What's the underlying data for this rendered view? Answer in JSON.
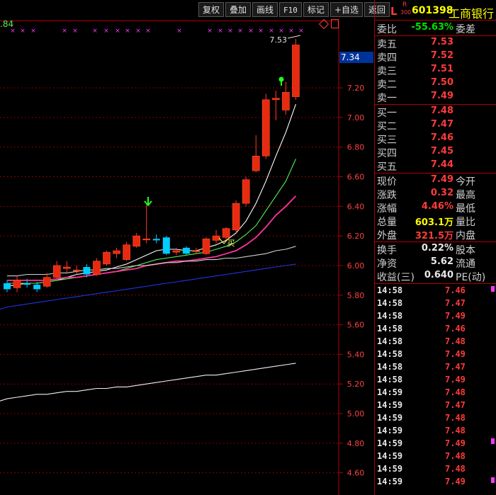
{
  "toolbar": {
    "buttons": [
      "复权",
      "叠加",
      "画线",
      "F10",
      "标记",
      "+自选",
      "返回"
    ]
  },
  "chart": {
    "top_left_value": ".84",
    "current_price_box": "7.34",
    "high_marker_label": "7.53",
    "buy_label": "买",
    "corner_icons": [
      "diamond-icon",
      "window-icon"
    ]
  },
  "stock": {
    "flag": "L",
    "sub_flag_top": "R",
    "sub_flag_bottom": "300",
    "code": "601398",
    "name": "工商银行"
  },
  "order_book": {
    "weibi_label": "委比",
    "weibi_value": "-55.63%",
    "weicha_label": "委差",
    "asks": [
      {
        "label": "卖五",
        "price": "7.53"
      },
      {
        "label": "卖四",
        "price": "7.52"
      },
      {
        "label": "卖三",
        "price": "7.51"
      },
      {
        "label": "卖二",
        "price": "7.50"
      },
      {
        "label": "卖一",
        "price": "7.49"
      }
    ],
    "bids": [
      {
        "label": "买一",
        "price": "7.48"
      },
      {
        "label": "买二",
        "price": "7.47"
      },
      {
        "label": "买三",
        "price": "7.46"
      },
      {
        "label": "买四",
        "price": "7.45"
      },
      {
        "label": "买五",
        "price": "7.44"
      }
    ]
  },
  "quote": {
    "rows": [
      {
        "k": "现价",
        "v": "7.49",
        "k2": "今开",
        "color": "red"
      },
      {
        "k": "涨跌",
        "v": "0.32",
        "k2": "最高",
        "color": "red"
      },
      {
        "k": "涨幅",
        "v": "4.46%",
        "k2": "最低",
        "color": "red"
      },
      {
        "k": "总量",
        "v": "603.1万",
        "k2": "量比",
        "color": "yellow"
      },
      {
        "k": "外盘",
        "v": "321.5万",
        "k2": "内盘",
        "color": "red"
      }
    ],
    "rows2": [
      {
        "k": "换手",
        "v": "0.22%",
        "k2": "股本",
        "color": "white"
      },
      {
        "k": "净资",
        "v": "5.62",
        "k2": "流通",
        "color": "white"
      },
      {
        "k": "收益(三)",
        "v": "0.640",
        "k2": "PE(动)",
        "color": "white"
      }
    ]
  },
  "ticks": [
    {
      "time": "14:58",
      "price": "7.46"
    },
    {
      "time": "14:58",
      "price": "7.47"
    },
    {
      "time": "14:58",
      "price": "7.49"
    },
    {
      "time": "14:58",
      "price": "7.46"
    },
    {
      "time": "14:58",
      "price": "7.48"
    },
    {
      "time": "14:58",
      "price": "7.49"
    },
    {
      "time": "14:58",
      "price": "7.47"
    },
    {
      "time": "14:58",
      "price": "7.49"
    },
    {
      "time": "14:59",
      "price": "7.48"
    },
    {
      "time": "14:59",
      "price": "7.47"
    },
    {
      "time": "14:59",
      "price": "7.48"
    },
    {
      "time": "14:59",
      "price": "7.48"
    },
    {
      "time": "14:59",
      "price": "7.49"
    },
    {
      "time": "14:59",
      "price": "7.48"
    },
    {
      "time": "14:59",
      "price": "7.48"
    },
    {
      "time": "14:59",
      "price": "7.49"
    }
  ],
  "chart_data": {
    "type": "candlestick",
    "y_axis_ticks": [
      "7.20",
      "7.00",
      "6.80",
      "6.60",
      "6.40",
      "6.20",
      "6.00",
      "5.80",
      "5.60",
      "5.40",
      "5.20",
      "5.00",
      "4.80",
      "4.60"
    ],
    "ylim": [
      4.45,
      7.65
    ],
    "candles": [
      {
        "o": 5.88,
        "c": 5.84,
        "h": 5.9,
        "l": 5.82
      },
      {
        "o": 5.85,
        "c": 5.9,
        "h": 5.93,
        "l": 5.82
      },
      {
        "o": 5.88,
        "c": 5.87,
        "h": 5.91,
        "l": 5.85
      },
      {
        "o": 5.87,
        "c": 5.84,
        "h": 5.89,
        "l": 5.82
      },
      {
        "o": 5.86,
        "c": 5.92,
        "h": 5.95,
        "l": 5.85
      },
      {
        "o": 5.92,
        "c": 6.0,
        "h": 6.03,
        "l": 5.9
      },
      {
        "o": 5.98,
        "c": 5.99,
        "h": 6.03,
        "l": 5.95
      },
      {
        "o": 5.97,
        "c": 5.97,
        "h": 6.0,
        "l": 5.94
      },
      {
        "o": 5.99,
        "c": 5.94,
        "h": 6.01,
        "l": 5.92
      },
      {
        "o": 5.94,
        "c": 6.03,
        "h": 6.05,
        "l": 5.93
      },
      {
        "o": 6.01,
        "c": 6.09,
        "h": 6.1,
        "l": 6.0
      },
      {
        "o": 6.08,
        "c": 6.1,
        "h": 6.12,
        "l": 6.05
      },
      {
        "o": 6.04,
        "c": 6.14,
        "h": 6.16,
        "l": 6.03
      },
      {
        "o": 6.13,
        "c": 6.2,
        "h": 6.22,
        "l": 6.12
      },
      {
        "o": 6.18,
        "c": 6.18,
        "h": 6.41,
        "l": 6.15
      },
      {
        "o": 6.18,
        "c": 6.17,
        "h": 6.21,
        "l": 6.15
      },
      {
        "o": 6.19,
        "c": 6.08,
        "h": 6.2,
        "l": 6.07
      },
      {
        "o": 6.09,
        "c": 6.1,
        "h": 6.12,
        "l": 6.07
      },
      {
        "o": 6.12,
        "c": 6.08,
        "h": 6.13,
        "l": 6.07
      },
      {
        "o": 6.1,
        "c": 6.1,
        "h": 6.12,
        "l": 6.08
      },
      {
        "o": 6.08,
        "c": 6.18,
        "h": 6.19,
        "l": 6.07
      },
      {
        "o": 6.17,
        "c": 6.2,
        "h": 6.24,
        "l": 6.15
      },
      {
        "o": 6.19,
        "c": 6.25,
        "h": 6.26,
        "l": 6.17
      },
      {
        "o": 6.24,
        "c": 6.42,
        "h": 6.44,
        "l": 6.22
      },
      {
        "o": 6.42,
        "c": 6.58,
        "h": 6.6,
        "l": 6.4
      },
      {
        "o": 6.64,
        "c": 6.74,
        "h": 6.88,
        "l": 6.63
      },
      {
        "o": 6.74,
        "c": 7.12,
        "h": 7.16,
        "l": 6.72
      },
      {
        "o": 7.12,
        "c": 7.13,
        "h": 7.18,
        "l": 6.98
      },
      {
        "o": 7.05,
        "c": 7.17,
        "h": 7.24,
        "l": 7.02
      },
      {
        "o": 7.14,
        "c": 7.49,
        "h": 7.53,
        "l": 7.12
      }
    ],
    "series": [
      {
        "name": "white-ma",
        "color": "#ffffff",
        "values": [
          5.86,
          5.87,
          5.88,
          5.88,
          5.89,
          5.9,
          5.92,
          5.94,
          5.95,
          5.96,
          5.97,
          5.99,
          6.01,
          6.04,
          6.07,
          6.1,
          6.11,
          6.11,
          6.1,
          6.1,
          6.12,
          6.14,
          6.17,
          6.22,
          6.3,
          6.42,
          6.57,
          6.74,
          6.9,
          7.09
        ]
      },
      {
        "name": "green-ma",
        "color": "#55ee55",
        "values": [
          5.88,
          5.88,
          5.88,
          5.88,
          5.89,
          5.9,
          5.91,
          5.92,
          5.93,
          5.94,
          5.95,
          5.96,
          5.98,
          6.0,
          6.02,
          6.04,
          6.05,
          6.06,
          6.07,
          6.08,
          6.09,
          6.11,
          6.13,
          6.16,
          6.21,
          6.27,
          6.37,
          6.47,
          6.57,
          6.72
        ]
      },
      {
        "name": "magenta-ma",
        "color": "#ff3399",
        "values": [
          5.9,
          5.9,
          5.9,
          5.9,
          5.9,
          5.91,
          5.92,
          5.92,
          5.93,
          5.94,
          5.95,
          5.96,
          5.97,
          5.98,
          6.0,
          6.01,
          6.02,
          6.03,
          6.03,
          6.04,
          6.05,
          6.06,
          6.08,
          6.1,
          6.14,
          6.19,
          6.26,
          6.34,
          6.4,
          6.47
        ]
      },
      {
        "name": "gray-ma",
        "color": "#d0d0d0",
        "values": [
          5.93,
          5.93,
          5.94,
          5.94,
          5.94,
          5.95,
          5.95,
          5.96,
          5.97,
          5.97,
          5.98,
          5.98,
          5.99,
          6.0,
          6.0,
          6.01,
          6.02,
          6.02,
          6.03,
          6.03,
          6.04,
          6.04,
          6.05,
          6.05,
          6.06,
          6.07,
          6.08,
          6.1,
          6.11,
          6.13
        ]
      },
      {
        "name": "blue-ma",
        "color": "#2233dd",
        "values": [
          5.72,
          5.73,
          5.74,
          5.75,
          5.76,
          5.77,
          5.78,
          5.79,
          5.8,
          5.81,
          5.82,
          5.83,
          5.84,
          5.85,
          5.86,
          5.87,
          5.88,
          5.89,
          5.9,
          5.91,
          5.92,
          5.93,
          5.94,
          5.95,
          5.96,
          5.97,
          5.98,
          5.99,
          6.0,
          6.01
        ]
      },
      {
        "name": "white-long-ma",
        "color": "#f0f0f0",
        "values": [
          5.1,
          5.11,
          5.12,
          5.13,
          5.13,
          5.14,
          5.15,
          5.15,
          5.16,
          5.17,
          5.17,
          5.18,
          5.18,
          5.19,
          5.2,
          5.21,
          5.22,
          5.23,
          5.24,
          5.25,
          5.26,
          5.26,
          5.27,
          5.28,
          5.29,
          5.3,
          5.31,
          5.32,
          5.33,
          5.34
        ]
      }
    ]
  }
}
